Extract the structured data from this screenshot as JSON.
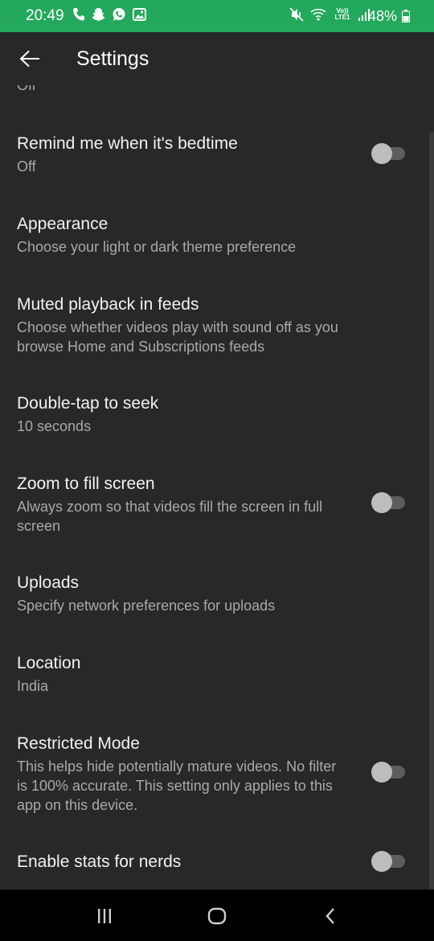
{
  "status_bar": {
    "time": "20:49",
    "battery": "48%",
    "network": "Vo)) LTE1",
    "left_icons": [
      "phone-icon",
      "snapchat-icon",
      "whatsapp-icon",
      "gallery-icon"
    ],
    "right_icons": [
      "mute-icon",
      "wifi-icon",
      "lte-icon",
      "signal-icon",
      "battery-icon"
    ],
    "background_color": "#23a85c"
  },
  "app_bar": {
    "title": "Settings",
    "back_icon": "arrow-left-icon"
  },
  "previous_item_value": "Off",
  "settings": [
    {
      "title": "Remind me when it's bedtime",
      "subtitle": "Off",
      "toggle": true,
      "toggle_state": "off"
    },
    {
      "title": "Appearance",
      "subtitle": "Choose your light or dark theme preference",
      "toggle": false
    },
    {
      "title": "Muted playback in feeds",
      "subtitle": "Choose whether videos play with sound off as you browse Home and Subscriptions feeds",
      "toggle": false
    },
    {
      "title": "Double-tap to seek",
      "subtitle": "10 seconds",
      "toggle": false
    },
    {
      "title": "Zoom to fill screen",
      "subtitle": "Always zoom so that videos fill the screen in full screen",
      "toggle": true,
      "toggle_state": "off"
    },
    {
      "title": "Uploads",
      "subtitle": "Specify network preferences for uploads",
      "toggle": false
    },
    {
      "title": "Location",
      "subtitle": "India",
      "toggle": false
    },
    {
      "title": "Restricted Mode",
      "subtitle": "This helps hide potentially mature videos. No filter is 100% accurate. This setting only applies to this app on this device.",
      "toggle": true,
      "toggle_state": "off"
    },
    {
      "title": "Enable stats for nerds",
      "subtitle": "",
      "toggle": true,
      "toggle_state": "off"
    }
  ],
  "nav_bar": {
    "buttons": [
      "recent-apps-icon",
      "home-icon",
      "back-chevron-icon"
    ]
  },
  "colors": {
    "background": "#282828",
    "title_text": "#f2f2f2",
    "subtitle_text": "#a9a9a9",
    "toggle_track": "#5d5d5d",
    "toggle_thumb": "#bdbdbd"
  }
}
